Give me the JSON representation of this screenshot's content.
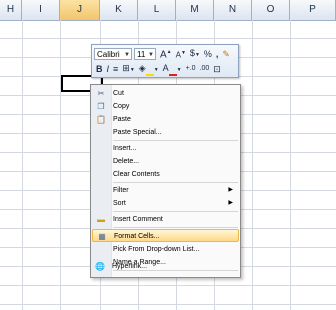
{
  "columns": [
    "H",
    "I",
    "J",
    "K",
    "L",
    "M",
    "N",
    "O",
    "P"
  ],
  "active_column": "J",
  "mini_toolbar": {
    "font": "Calibri",
    "size": "11",
    "grow_font": "A",
    "shrink_font": "A",
    "currency": "$",
    "percent": "%",
    "comma": ",",
    "bold": "B",
    "italic": "I",
    "font_color": "A",
    "increase_decimal": "+.0",
    "decrease_decimal": ".00"
  },
  "context_menu": {
    "items": [
      {
        "label": "Cut",
        "icon": "scissors-icon"
      },
      {
        "label": "Copy",
        "icon": "copy-icon"
      },
      {
        "label": "Paste",
        "icon": "paste-icon"
      },
      {
        "label": "Paste Special..."
      },
      {
        "label": "Insert..."
      },
      {
        "label": "Delete..."
      },
      {
        "label": "Clear Contents"
      },
      {
        "label": "Filter",
        "submenu": true
      },
      {
        "label": "Sort",
        "submenu": true
      },
      {
        "label": "Insert Comment",
        "icon": "comment-icon"
      },
      {
        "label": "Format Cells...",
        "icon": "format-cells-icon",
        "highlighted": true
      },
      {
        "label": "Pick From Drop-down List..."
      },
      {
        "label": "Name a Range..."
      },
      {
        "label": "Hyperlink...",
        "icon": "hyperlink-icon"
      }
    ]
  }
}
